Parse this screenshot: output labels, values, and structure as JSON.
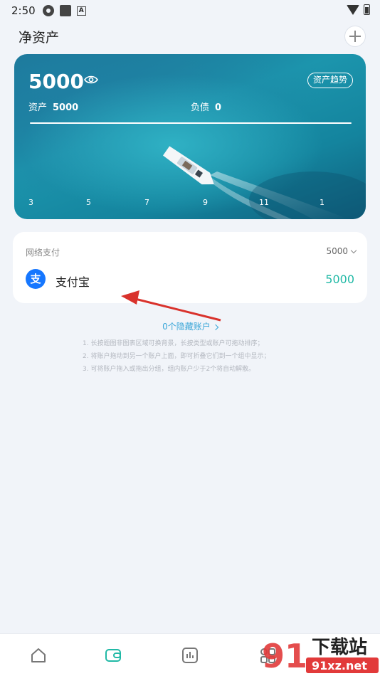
{
  "status_bar": {
    "time": "2:50",
    "icons": [
      "gear-icon",
      "square-icon",
      "font-a-icon",
      "wifi-icon",
      "battery-icon"
    ]
  },
  "header": {
    "title": "净资产",
    "add_icon": "plus-icon"
  },
  "summary": {
    "net_assets": "5000",
    "visibility_icon": "eye-icon",
    "trend_label": "资产趋势",
    "assets_label": "资产",
    "assets_value": "5000",
    "debt_label": "负债",
    "debt_value": "0",
    "axis_labels": [
      "3",
      "5",
      "7",
      "9",
      "11",
      "1"
    ],
    "line_color": "#ffffff"
  },
  "account_group": {
    "name": "网络支付",
    "total": "5000",
    "accounts": [
      {
        "name": "支付宝",
        "balance": "5000",
        "icon": "alipay-icon",
        "icon_glyph": "支",
        "icon_color": "#1677ff",
        "balance_color": "#21b9a6"
      }
    ]
  },
  "hidden_accounts": {
    "label": "0个隐藏账户"
  },
  "tips": [
    "1. 长按题图非图表区域可换背景，长按类型或账户可拖动排序；",
    "2. 将账户拖动到另一个账户上面，即可折叠它们到一个组中显示；",
    "3. 可将账户拖入或拖出分组，组内账户少于2个将自动解散。"
  ],
  "bottom_nav": {
    "items": [
      "home-icon",
      "wallet-icon",
      "chart-icon",
      "apps-icon"
    ],
    "active": "wallet-icon",
    "active_color": "#21b9a6"
  },
  "watermark": {
    "brand": "下载站",
    "domain": "91xz.net",
    "logo": "91"
  }
}
